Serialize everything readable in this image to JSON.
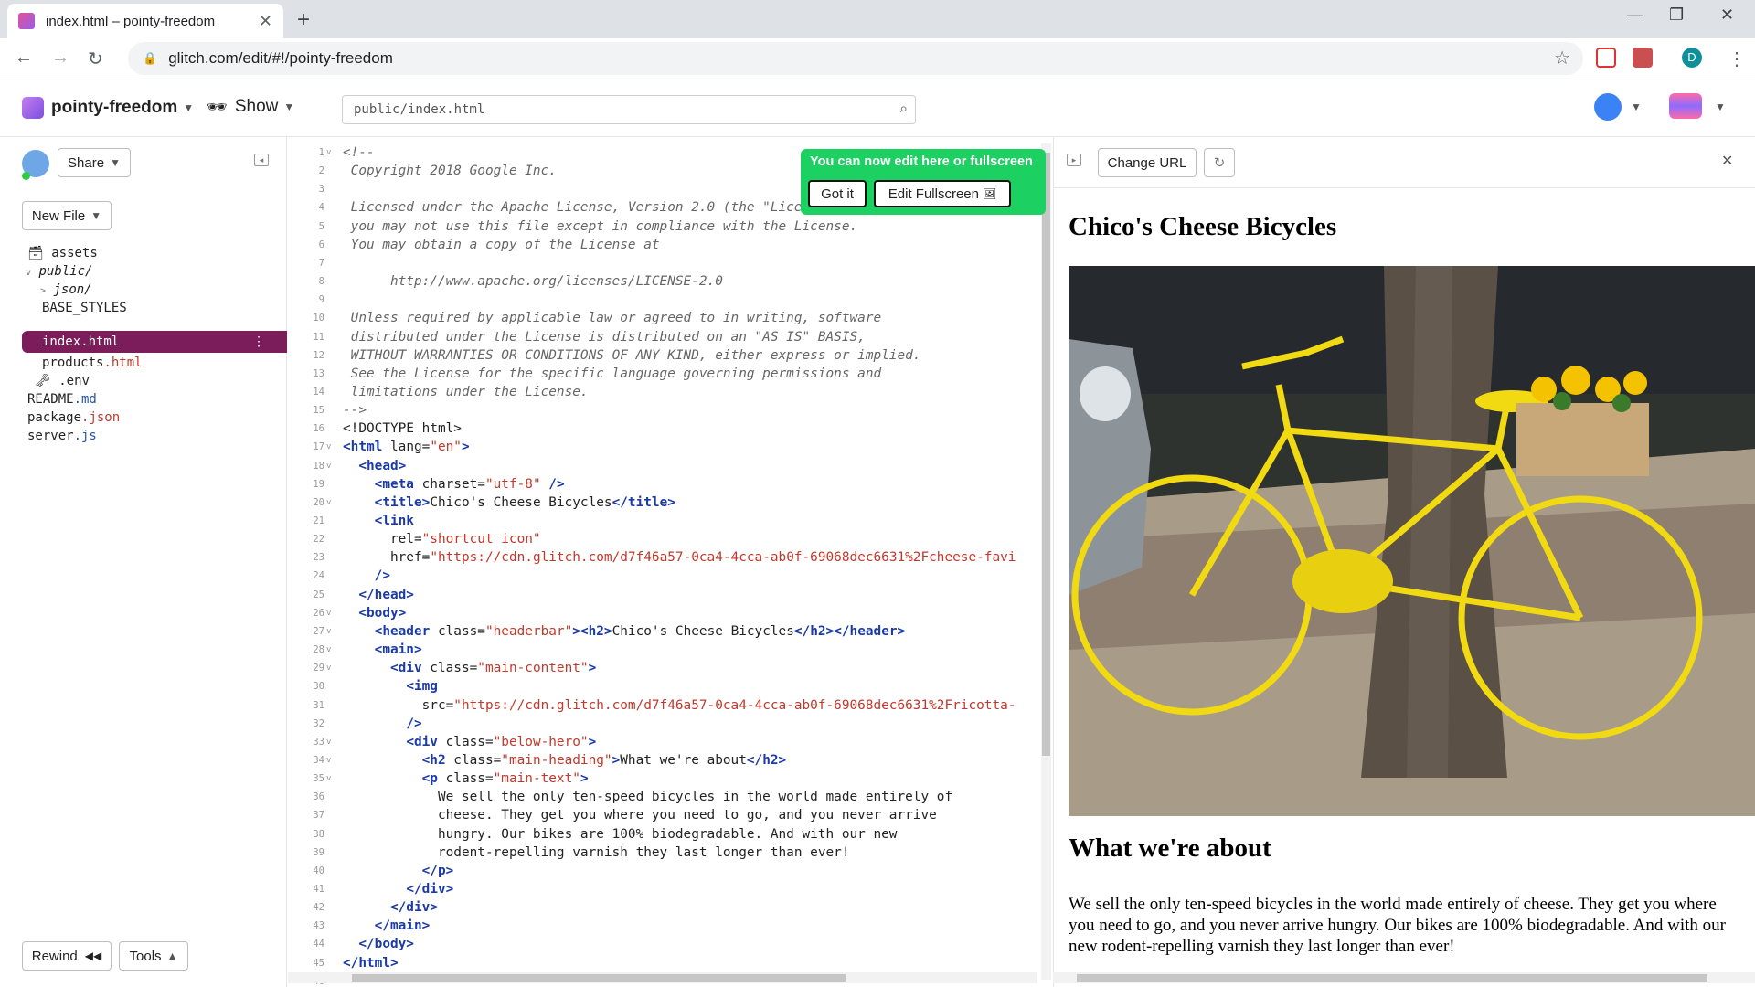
{
  "browser": {
    "tab_title": "index.html – pointy-freedom",
    "tab_close": "✕",
    "new_tab": "+",
    "url": "glitch.com/edit/#!/pointy-freedom",
    "profile_initial": "D"
  },
  "header": {
    "project_name": "pointy-freedom",
    "show_label": "Show",
    "file_path": "public/index.html"
  },
  "sidebar": {
    "share_label": "Share",
    "new_file_label": "New File",
    "rewind_label": "Rewind",
    "tools_label": "Tools",
    "files": {
      "assets": "assets",
      "public": "public/",
      "json": "json/",
      "base_styles": "BASE_STYLES",
      "index": "index.html",
      "products_name": "products",
      "products_ext": ".html",
      "env": ".env",
      "readme_name": "README",
      "readme_ext": ".md",
      "package_name": "package",
      "package_ext": ".json",
      "server_name": "server",
      "server_ext": ".js"
    }
  },
  "toast": {
    "message": "You can now edit here or fullscreen",
    "got_it": "Got it",
    "edit_fullscreen": "Edit Fullscreen"
  },
  "editor": {
    "lines": [
      {
        "n": "1",
        "fold": true,
        "parts": [
          [
            "cm",
            "<!--"
          ]
        ]
      },
      {
        "n": "2",
        "parts": [
          [
            "cm",
            " Copyright 2018 Google Inc."
          ]
        ]
      },
      {
        "n": "3",
        "parts": []
      },
      {
        "n": "4",
        "parts": [
          [
            "cm",
            " Licensed under the Apache License, Version 2.0 (the \"License\");"
          ]
        ]
      },
      {
        "n": "5",
        "parts": [
          [
            "cm",
            " you may not use this file except in compliance with the License."
          ]
        ]
      },
      {
        "n": "6",
        "parts": [
          [
            "cm",
            " You may obtain a copy of the License at"
          ]
        ]
      },
      {
        "n": "7",
        "parts": []
      },
      {
        "n": "8",
        "parts": [
          [
            "cm",
            "      http://www.apache.org/licenses/LICENSE-2.0"
          ]
        ]
      },
      {
        "n": "9",
        "parts": []
      },
      {
        "n": "10",
        "parts": [
          [
            "cm",
            " Unless required by applicable law or agreed to in writing, software"
          ]
        ]
      },
      {
        "n": "11",
        "parts": [
          [
            "cm",
            " distributed under the License is distributed on an \"AS IS\" BASIS,"
          ]
        ]
      },
      {
        "n": "12",
        "parts": [
          [
            "cm",
            " WITHOUT WARRANTIES OR CONDITIONS OF ANY KIND, either express or implied."
          ]
        ]
      },
      {
        "n": "13",
        "parts": [
          [
            "cm",
            " See the License for the specific language governing permissions and"
          ]
        ]
      },
      {
        "n": "14",
        "parts": [
          [
            "cm",
            " limitations under the License."
          ]
        ]
      },
      {
        "n": "15",
        "parts": [
          [
            "cm",
            "-->"
          ]
        ]
      },
      {
        "n": "16",
        "parts": [
          [
            "at",
            "<!DOCTYPE html>"
          ]
        ]
      },
      {
        "n": "17",
        "fold": true,
        "parts": [
          [
            "tg",
            "<html"
          ],
          [
            "at",
            " lang="
          ],
          [
            "st",
            "\"en\""
          ],
          [
            "tg",
            ">"
          ]
        ]
      },
      {
        "n": "18",
        "fold": true,
        "parts": [
          [
            "at",
            "  "
          ],
          [
            "tg",
            "<head>"
          ]
        ]
      },
      {
        "n": "19",
        "parts": [
          [
            "at",
            "    "
          ],
          [
            "tg",
            "<meta"
          ],
          [
            "at",
            " charset="
          ],
          [
            "st",
            "\"utf-8\""
          ],
          [
            "at",
            " "
          ],
          [
            "tg",
            "/>"
          ]
        ]
      },
      {
        "n": "20",
        "fold": true,
        "parts": [
          [
            "at",
            "    "
          ],
          [
            "tg",
            "<title>"
          ],
          [
            "at",
            "Chico's Cheese Bicycles"
          ],
          [
            "tg",
            "</title>"
          ]
        ]
      },
      {
        "n": "21",
        "parts": [
          [
            "at",
            "    "
          ],
          [
            "tg",
            "<link"
          ]
        ]
      },
      {
        "n": "22",
        "parts": [
          [
            "at",
            "      rel="
          ],
          [
            "st",
            "\"shortcut icon\""
          ]
        ]
      },
      {
        "n": "23",
        "parts": [
          [
            "at",
            "      href="
          ],
          [
            "st",
            "\"https://cdn.glitch.com/d7f46a57-0ca4-4cca-ab0f-69068dec6631%2Fcheese-favi"
          ]
        ]
      },
      {
        "n": "24",
        "parts": [
          [
            "at",
            "    "
          ],
          [
            "tg",
            "/>"
          ]
        ]
      },
      {
        "n": "25",
        "parts": [
          [
            "at",
            "  "
          ],
          [
            "tg",
            "</head>"
          ]
        ]
      },
      {
        "n": "26",
        "fold": true,
        "parts": [
          [
            "at",
            "  "
          ],
          [
            "tg",
            "<body>"
          ]
        ]
      },
      {
        "n": "27",
        "fold": true,
        "parts": [
          [
            "at",
            "    "
          ],
          [
            "tg",
            "<header"
          ],
          [
            "at",
            " class="
          ],
          [
            "st",
            "\"headerbar\""
          ],
          [
            "tg",
            "><h2>"
          ],
          [
            "at",
            "Chico's Cheese Bicycles"
          ],
          [
            "tg",
            "</h2></header>"
          ]
        ]
      },
      {
        "n": "28",
        "fold": true,
        "parts": [
          [
            "at",
            "    "
          ],
          [
            "tg",
            "<main>"
          ]
        ]
      },
      {
        "n": "29",
        "fold": true,
        "parts": [
          [
            "at",
            "      "
          ],
          [
            "tg",
            "<div"
          ],
          [
            "at",
            " class="
          ],
          [
            "st",
            "\"main-content\""
          ],
          [
            "tg",
            ">"
          ]
        ]
      },
      {
        "n": "30",
        "parts": [
          [
            "at",
            "        "
          ],
          [
            "tg",
            "<img"
          ]
        ]
      },
      {
        "n": "31",
        "parts": [
          [
            "at",
            "          src="
          ],
          [
            "st",
            "\"https://cdn.glitch.com/d7f46a57-0ca4-4cca-ab0f-69068dec6631%2Fricotta-"
          ]
        ]
      },
      {
        "n": "32",
        "parts": [
          [
            "at",
            "        "
          ],
          [
            "tg",
            "/>"
          ]
        ]
      },
      {
        "n": "33",
        "fold": true,
        "parts": [
          [
            "at",
            "        "
          ],
          [
            "tg",
            "<div"
          ],
          [
            "at",
            " class="
          ],
          [
            "st",
            "\"below-hero\""
          ],
          [
            "tg",
            ">"
          ]
        ]
      },
      {
        "n": "34",
        "fold": true,
        "parts": [
          [
            "at",
            "          "
          ],
          [
            "tg",
            "<h2"
          ],
          [
            "at",
            " class="
          ],
          [
            "st",
            "\"main-heading\""
          ],
          [
            "tg",
            ">"
          ],
          [
            "at",
            "What we're about"
          ],
          [
            "tg",
            "</h2>"
          ]
        ]
      },
      {
        "n": "35",
        "fold": true,
        "parts": [
          [
            "at",
            "          "
          ],
          [
            "tg",
            "<p"
          ],
          [
            "at",
            " class="
          ],
          [
            "st",
            "\"main-text\""
          ],
          [
            "tg",
            ">"
          ]
        ]
      },
      {
        "n": "36",
        "parts": [
          [
            "at",
            "            We sell the only ten-speed bicycles in the world made entirely of"
          ]
        ]
      },
      {
        "n": "37",
        "parts": [
          [
            "at",
            "            cheese. They get you where you need to go, and you never arrive"
          ]
        ]
      },
      {
        "n": "38",
        "parts": [
          [
            "at",
            "            hungry. Our bikes are 100% biodegradable. And with our new"
          ]
        ]
      },
      {
        "n": "39",
        "parts": [
          [
            "at",
            "            rodent-repelling varnish they last longer than ever!"
          ]
        ]
      },
      {
        "n": "40",
        "parts": [
          [
            "at",
            "          "
          ],
          [
            "tg",
            "</p>"
          ]
        ]
      },
      {
        "n": "41",
        "parts": [
          [
            "at",
            "        "
          ],
          [
            "tg",
            "</div>"
          ]
        ]
      },
      {
        "n": "42",
        "parts": [
          [
            "at",
            "      "
          ],
          [
            "tg",
            "</div>"
          ]
        ]
      },
      {
        "n": "43",
        "parts": [
          [
            "at",
            "    "
          ],
          [
            "tg",
            "</main>"
          ]
        ]
      },
      {
        "n": "44",
        "parts": [
          [
            "at",
            "  "
          ],
          [
            "tg",
            "</body>"
          ]
        ]
      },
      {
        "n": "45",
        "parts": [
          [
            "tg",
            "</html>"
          ]
        ]
      },
      {
        "n": "46",
        "parts": []
      }
    ]
  },
  "preview": {
    "change_url_label": "Change URL",
    "title": "Chico's Cheese Bicycles",
    "heading": "What we're about",
    "text": "We sell the only ten-speed bicycles in the world made entirely of cheese. They get you where you need to go, and you never arrive hungry. Our bikes are 100% biodegradable. And with our new rodent-repelling varnish they last longer than ever!"
  },
  "colors": {
    "selected_file": "#7b1d5b",
    "toast": "#1cd061",
    "tag": "#1a3aa8",
    "string": "#c0392b"
  }
}
